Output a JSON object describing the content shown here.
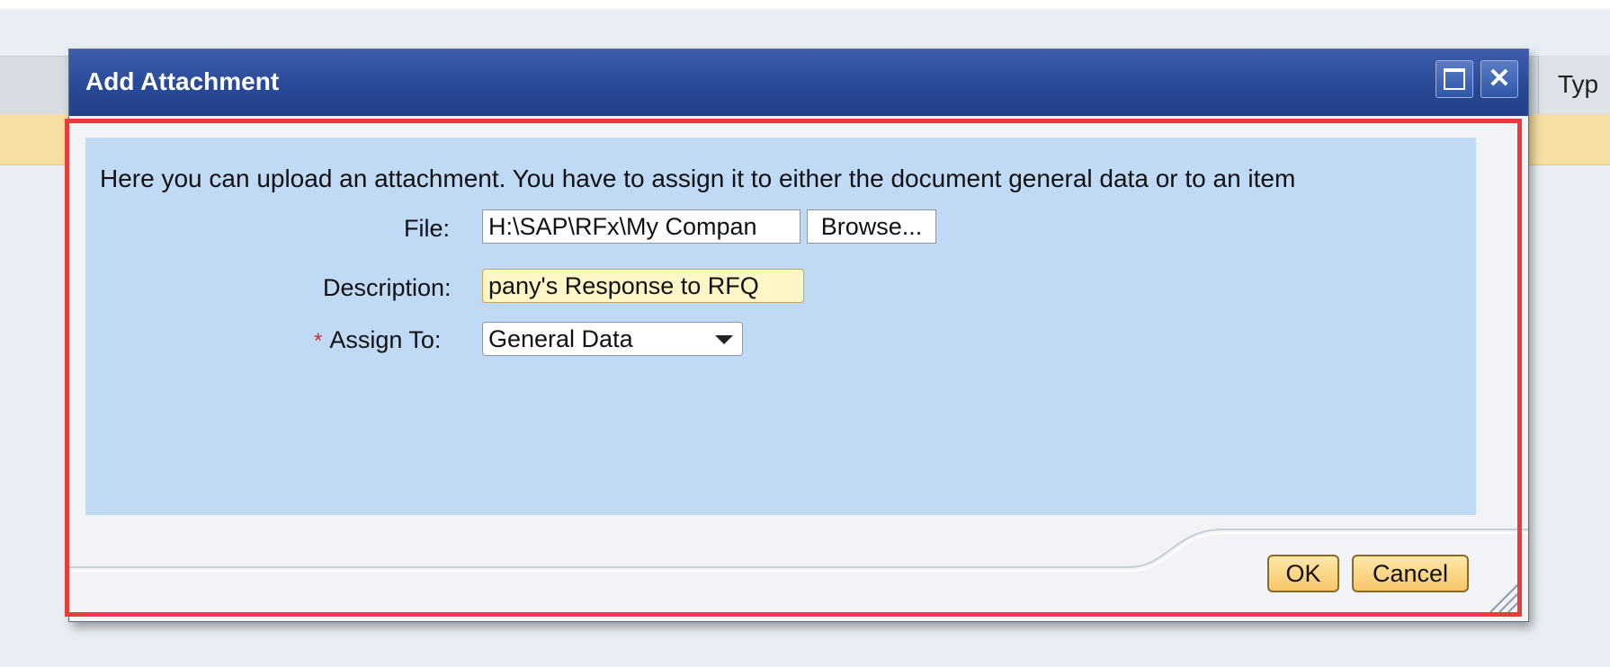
{
  "background": {
    "column_header": "Typ"
  },
  "dialog": {
    "title": "Add Attachment",
    "maximize_icon": "maximize-icon",
    "close_icon": "close-icon",
    "close_glyph": "✕",
    "intro_text": "Here you can upload an attachment. You have to assign it to either the document general data or to an item",
    "file": {
      "label": "File:",
      "value": "H:\\SAP\\RFx\\My Compan",
      "browse_label": "Browse..."
    },
    "description": {
      "label": "Description:",
      "value": "pany's Response to RFQ"
    },
    "assign_to": {
      "required_mark": "*",
      "label": "Assign To:",
      "value": "General Data"
    },
    "buttons": {
      "ok": "OK",
      "cancel": "Cancel"
    }
  },
  "colors": {
    "title_bar": "#284a96",
    "content_bg": "#c0d9f5",
    "highlight_border": "#ea3b3b",
    "button_bg": "#f7c66a",
    "description_bg": "#fff6c7"
  }
}
